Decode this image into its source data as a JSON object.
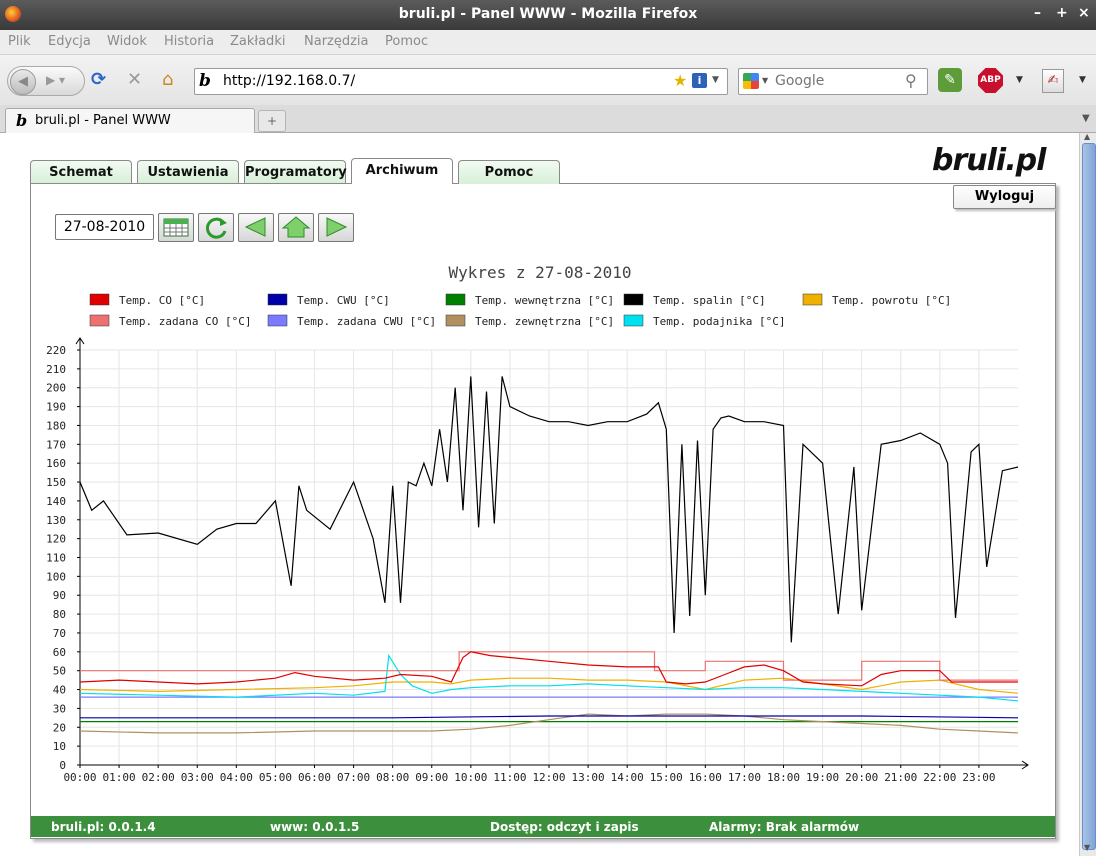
{
  "window": {
    "title": "bruli.pl - Panel WWW - Mozilla Firefox",
    "controls": [
      "–",
      "+",
      "×"
    ]
  },
  "menu": [
    "Plik",
    "Edycja",
    "Widok",
    "Historia",
    "Zakładki",
    "Narzędzia",
    "Pomoc"
  ],
  "toolbar": {
    "url": "http://192.168.0.7/",
    "search_placeholder": "Google"
  },
  "browser_tab": {
    "label": "bruli.pl - Panel WWW",
    "new_tab": "+"
  },
  "page": {
    "logo": "bruli.pl",
    "tabs": [
      "Schemat",
      "Ustawienia",
      "Programatory",
      "Archiwum",
      "Pomoc"
    ],
    "active_tab": "Archiwum",
    "logout": "Wyloguj",
    "date": "27-08-2010",
    "footer": {
      "version": "bruli.pl: 0.0.1.4",
      "www": "www: 0.0.1.5",
      "access": "Dostęp: odczyt i zapis",
      "alarms": "Alarmy: Brak alarmów"
    }
  },
  "chart_data": {
    "type": "line",
    "title": "Wykres z 27-08-2010",
    "xlabel": "",
    "ylabel": "",
    "ylim": [
      0,
      220
    ],
    "xlim": [
      0,
      24
    ],
    "x_ticks": [
      "00:00",
      "01:00",
      "02:00",
      "03:00",
      "04:00",
      "05:00",
      "06:00",
      "07:00",
      "08:00",
      "09:00",
      "10:00",
      "11:00",
      "12:00",
      "13:00",
      "14:00",
      "15:00",
      "16:00",
      "17:00",
      "18:00",
      "19:00",
      "20:00",
      "21:00",
      "22:00",
      "23:00"
    ],
    "y_ticks": [
      0,
      10,
      20,
      30,
      40,
      50,
      60,
      70,
      80,
      90,
      100,
      110,
      120,
      130,
      140,
      150,
      160,
      170,
      180,
      190,
      200,
      210,
      220
    ],
    "grid": true,
    "legend_position": "top",
    "series": [
      {
        "name": "Temp. CO [°C]",
        "color": "#e00000",
        "x": [
          0,
          1,
          2,
          3,
          4,
          5,
          5.5,
          6,
          7,
          7.8,
          8.2,
          9,
          9.5,
          9.8,
          10,
          10.5,
          11,
          12,
          13,
          14,
          14.8,
          15,
          15.5,
          16,
          16.5,
          17,
          17.5,
          18,
          18.5,
          19,
          20,
          20.5,
          21,
          22,
          22.3,
          23,
          24
        ],
        "y": [
          44,
          45,
          44,
          43,
          44,
          46,
          49,
          47,
          45,
          46,
          48,
          47,
          44,
          57,
          60,
          58,
          57,
          55,
          53,
          52,
          52,
          44,
          43,
          44,
          48,
          52,
          53,
          50,
          44,
          43,
          42,
          48,
          50,
          50,
          44,
          44,
          44
        ]
      },
      {
        "name": "Temp. zadana CO [°C]",
        "color": "#ee7070",
        "x": [
          0,
          9.7,
          9.7,
          14.7,
          14.7,
          16,
          16,
          18,
          18,
          20,
          20,
          22,
          22,
          24
        ],
        "y": [
          50,
          50,
          60,
          60,
          50,
          50,
          55,
          55,
          45,
          45,
          55,
          55,
          45,
          45
        ]
      },
      {
        "name": "Temp. CWU [°C]",
        "color": "#0000a8",
        "x": [
          0,
          4,
          8,
          12,
          16,
          20,
          24
        ],
        "y": [
          25,
          25,
          25,
          26,
          26,
          26,
          25
        ]
      },
      {
        "name": "Temp. zadana CWU [°C]",
        "color": "#7b7bff",
        "x": [
          0,
          24
        ],
        "y": [
          36,
          36
        ]
      },
      {
        "name": "Temp. wewnętrzna [°C]",
        "color": "#008000",
        "x": [
          0,
          4,
          8,
          12,
          16,
          20,
          24
        ],
        "y": [
          23,
          23,
          23,
          23,
          23,
          23,
          23
        ]
      },
      {
        "name": "Temp. zewnętrzna [°C]",
        "color": "#b09060",
        "x": [
          0,
          2,
          4,
          6,
          8,
          9,
          10,
          11,
          12,
          13,
          14,
          15,
          16,
          17,
          18,
          19,
          20,
          21,
          22,
          23,
          24
        ],
        "y": [
          18,
          17,
          17,
          18,
          18,
          18,
          19,
          21,
          24,
          27,
          26,
          27,
          27,
          26,
          24,
          23,
          22,
          21,
          19,
          18,
          17
        ]
      },
      {
        "name": "Temp. spalin [°C]",
        "color": "#000000",
        "x": [
          0,
          0.3,
          0.6,
          1.2,
          2,
          3,
          3.5,
          4,
          4.5,
          5,
          5.4,
          5.6,
          5.8,
          6.4,
          7,
          7.5,
          7.8,
          8,
          8.2,
          8.4,
          8.6,
          8.8,
          9,
          9.2,
          9.4,
          9.6,
          9.8,
          10,
          10.2,
          10.4,
          10.6,
          10.8,
          11,
          11.5,
          12,
          12.5,
          13,
          13.5,
          14,
          14.5,
          14.8,
          15,
          15.2,
          15.4,
          15.6,
          15.8,
          16,
          16.2,
          16.4,
          16.6,
          17,
          17.5,
          18,
          18.2,
          18.5,
          19,
          19.4,
          19.8,
          20,
          20.5,
          21,
          21.5,
          22,
          22.2,
          22.4,
          22.8,
          23,
          23.2,
          23.6,
          24
        ],
        "y": [
          150,
          135,
          140,
          122,
          123,
          117,
          125,
          128,
          128,
          140,
          95,
          148,
          135,
          125,
          150,
          120,
          86,
          148,
          86,
          150,
          148,
          160,
          148,
          178,
          150,
          200,
          135,
          206,
          126,
          198,
          128,
          206,
          190,
          185,
          182,
          182,
          180,
          182,
          182,
          186,
          192,
          178,
          70,
          170,
          79,
          172,
          90,
          178,
          184,
          185,
          182,
          182,
          180,
          65,
          170,
          160,
          80,
          158,
          82,
          170,
          172,
          176,
          170,
          160,
          78,
          166,
          170,
          105,
          156,
          158
        ]
      },
      {
        "name": "Temp. podajnika [°C]",
        "color": "#00e0f0",
        "x": [
          0,
          2,
          4,
          6,
          7,
          7.8,
          7.9,
          8.2,
          8.5,
          9,
          9.5,
          10,
          11,
          12,
          13,
          14,
          15,
          16,
          17,
          18,
          19,
          20,
          21,
          22,
          23,
          24
        ],
        "y": [
          38,
          37,
          36,
          38,
          37,
          39,
          58,
          48,
          42,
          38,
          40,
          41,
          42,
          42,
          43,
          42,
          41,
          40,
          41,
          41,
          40,
          39,
          38,
          37,
          36,
          34
        ]
      },
      {
        "name": "Temp. powrotu [°C]",
        "color": "#f0b000",
        "x": [
          0,
          2,
          4,
          6,
          7,
          8,
          9,
          9.5,
          10,
          11,
          12,
          13,
          14,
          15,
          16,
          17,
          18,
          19,
          20,
          21,
          22,
          23,
          24
        ],
        "y": [
          40,
          39,
          40,
          41,
          42,
          44,
          44,
          43,
          45,
          46,
          46,
          45,
          45,
          44,
          40,
          45,
          46,
          43,
          40,
          44,
          45,
          40,
          38
        ]
      }
    ]
  }
}
